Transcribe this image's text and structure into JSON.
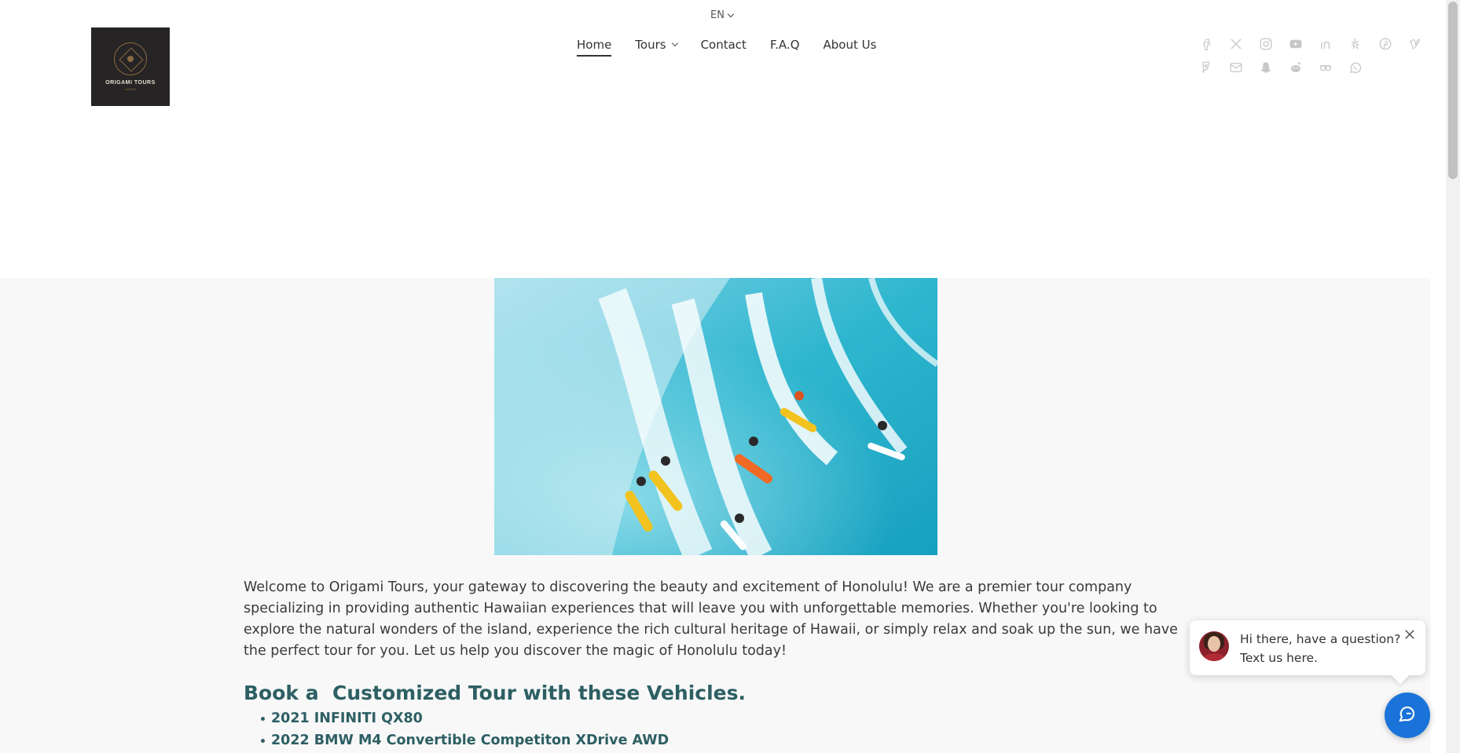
{
  "header": {
    "language": "EN",
    "logo": {
      "title": "ORIGAMI TOURS",
      "subtitle": "HAWAII"
    },
    "nav": [
      {
        "label": "Home",
        "active": true
      },
      {
        "label": "Tours",
        "dropdown": true
      },
      {
        "label": "Contact"
      },
      {
        "label": "F.A.Q"
      },
      {
        "label": "About Us"
      }
    ],
    "social_icons": [
      "facebook-icon",
      "x-icon",
      "instagram-icon",
      "youtube-icon",
      "linkedin-icon",
      "yelp-icon",
      "pinterest-icon",
      "vimeo-icon",
      "foursquare-icon",
      "email-icon",
      "snapchat-icon",
      "reddit-icon",
      "tripadvisor-icon",
      "whatsapp-icon"
    ],
    "social_color": "#c8c8c8"
  },
  "main": {
    "hero_alt": "surfers-riding-wave",
    "intro": "Welcome to Origami Tours, your gateway to discovering the beauty and excitement of Honolulu! We are a premier tour company specializing in providing authentic Hawaiian experiences that will leave you with unforgettable memories. Whether you're looking to explore the natural wonders of the island, experience the rich cultural heritage of Hawaii, or simply relax and soak up the sun, we have the perfect tour for you. Let us help you discover the magic of Honolulu today!",
    "heading": "Book a  Customized Tour with these Vehicles.",
    "vehicles": [
      "2021 INFINITI QX80",
      "2022 BMW M4 Convertible Competiton XDrive AWD"
    ]
  },
  "chat": {
    "line1": "Hi there, have a question?",
    "line2": "Text us here.",
    "button_color": "#1a73d9"
  },
  "colors": {
    "accent": "#2d5f63",
    "band": "#f8f8f8"
  }
}
